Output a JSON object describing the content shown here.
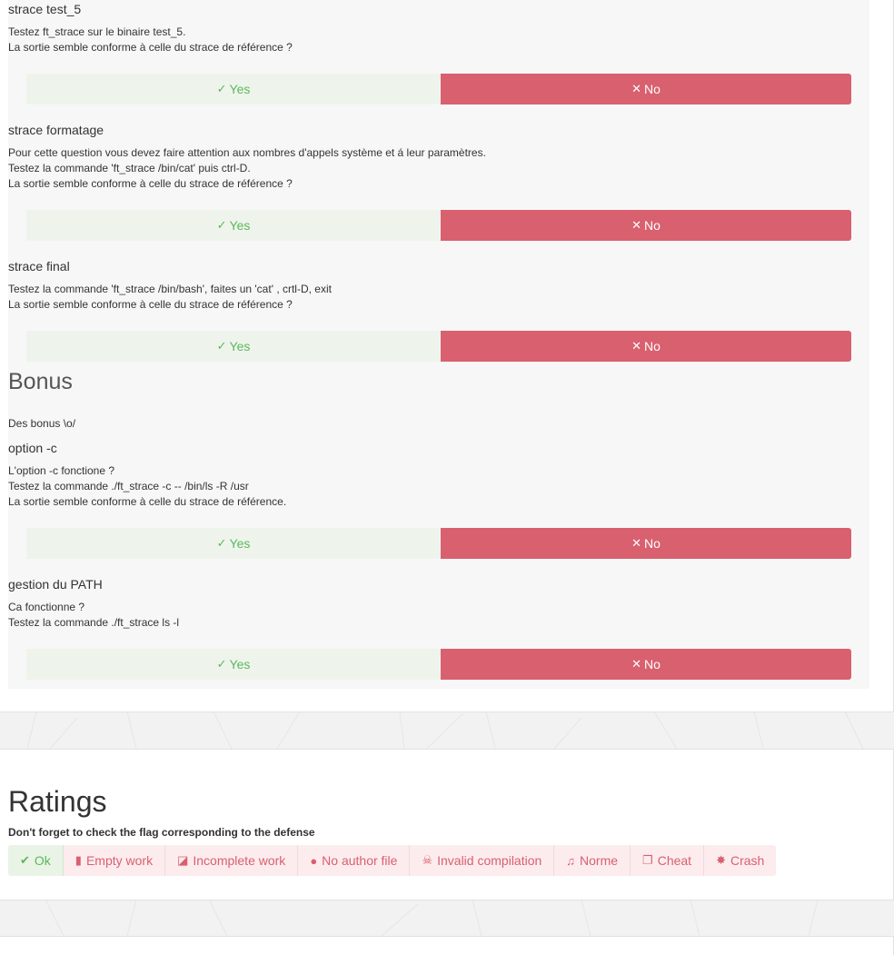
{
  "buttons": {
    "yes_label": "Yes",
    "no_label": "No"
  },
  "questions": [
    {
      "title": "strace test_5",
      "lines": [
        "Testez ft_strace sur le binaire test_5.",
        "La sortie semble conforme à celle du strace de référence ?"
      ]
    },
    {
      "title": "strace formatage",
      "lines": [
        "Pour cette question vous devez faire attention aux nombres d'appels système et á leur paramètres.",
        "Testez la commande 'ft_strace /bin/cat' puis ctrl-D.",
        "La sortie semble conforme à celle du strace de référence ?"
      ]
    },
    {
      "title": "strace final",
      "lines": [
        "Testez la commande 'ft_strace /bin/bash', faites un 'cat' , crtl-D, exit",
        "La sortie semble conforme à celle du strace de référence ?"
      ]
    }
  ],
  "bonus": {
    "title": "Bonus",
    "description": "Des bonus \\o/",
    "questions": [
      {
        "title": "option -c",
        "lines": [
          "L'option -c fonctione ?",
          "Testez la commande ./ft_strace -c -- /bin/ls -R /usr",
          "La sortie semble conforme à celle du strace de référence."
        ]
      },
      {
        "title": "gestion du PATH",
        "lines": [
          "Ca fonctionne ?",
          "Testez la commande ./ft_strace ls -l"
        ]
      }
    ]
  },
  "ratings": {
    "title": "Ratings",
    "subtitle": "Don't forget to check the flag corresponding to the defense",
    "flags": [
      {
        "label": "Ok",
        "icon": "check-icon"
      },
      {
        "label": "Empty work",
        "icon": "file-icon"
      },
      {
        "label": "Incomplete work",
        "icon": "file-broken-icon"
      },
      {
        "label": "No author file",
        "icon": "comment-icon"
      },
      {
        "label": "Invalid compilation",
        "icon": "skull-icon"
      },
      {
        "label": "Norme",
        "icon": "music-icon"
      },
      {
        "label": "Cheat",
        "icon": "copy-icon"
      },
      {
        "label": "Crash",
        "icon": "explosion-icon"
      }
    ]
  },
  "colors": {
    "yes": "#5cb85c",
    "yes_bg": "#eef4ec",
    "no_bg": "#d9606f",
    "flag_text": "#d9606f",
    "flag_bg": "#fcecee"
  }
}
